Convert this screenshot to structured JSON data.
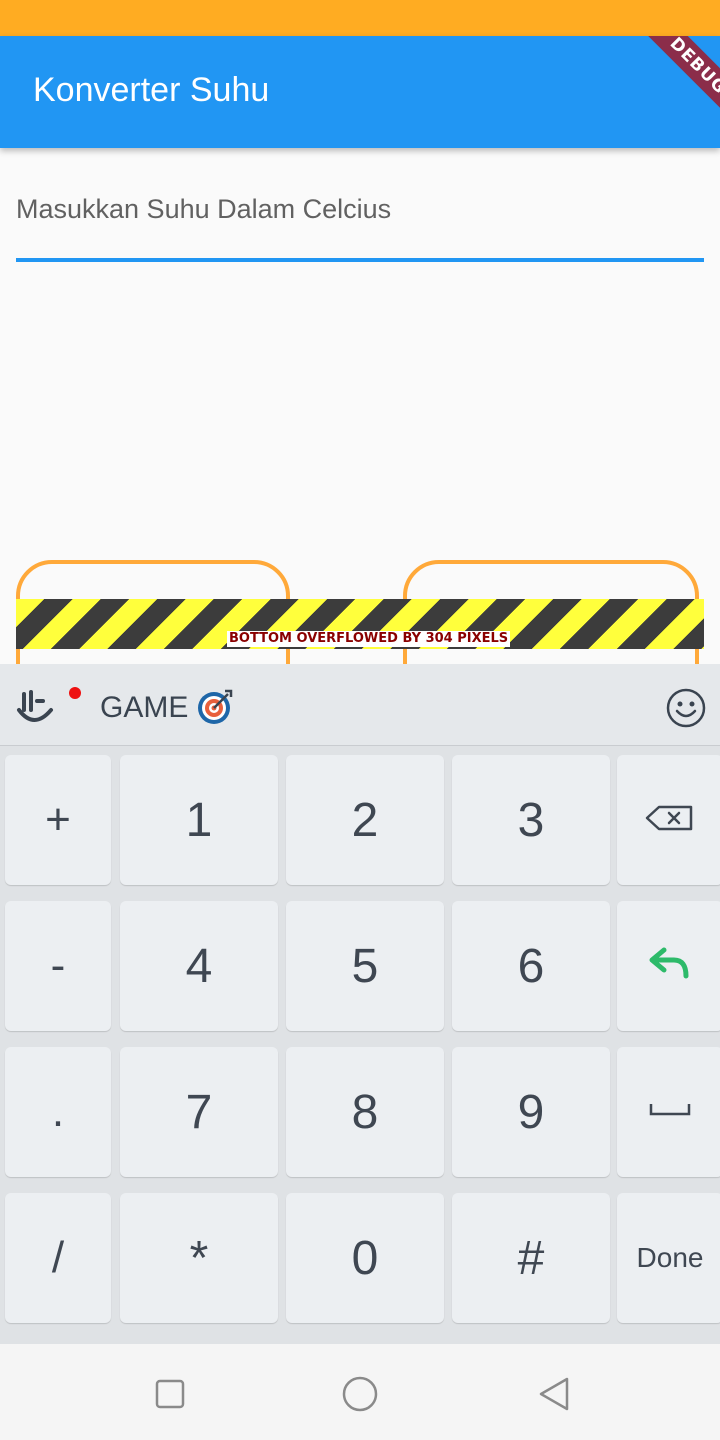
{
  "status_bar": {},
  "app_bar": {
    "title": "Konverter Suhu",
    "debug_banner": "DEBUG"
  },
  "form": {
    "input_label": "Masukkan Suhu Dalam Celcius",
    "input_value": ""
  },
  "overflow_warning": "BOTTOM OVERFLOWED BY 304 PIXELS",
  "keyboard": {
    "toolbar": {
      "game_label": "GAME",
      "icons": [
        "hand-icon",
        "notification-dot",
        "target-icon",
        "emoji-icon"
      ]
    },
    "rows": [
      [
        "+",
        "1",
        "2",
        "3",
        "backspace"
      ],
      [
        "-",
        "4",
        "5",
        "6",
        "enter"
      ],
      [
        ".",
        "7",
        "8",
        "9",
        "space"
      ],
      [
        "/",
        "*",
        "0",
        "#",
        "Done"
      ]
    ],
    "keys": {
      "plus": "+",
      "one": "1",
      "two": "2",
      "three": "3",
      "minus": "-",
      "four": "4",
      "five": "5",
      "six": "6",
      "dot": ".",
      "seven": "7",
      "eight": "8",
      "nine": "9",
      "slash": "/",
      "star": "*",
      "zero": "0",
      "hash": "#",
      "done": "Done"
    }
  },
  "nav_bar": {
    "buttons": [
      "recent-apps-icon",
      "home-icon",
      "back-icon"
    ]
  },
  "colors": {
    "status_bar": "#ffac22",
    "app_bar": "#2196f3",
    "input_underline": "#2196f3",
    "button_outline": "#ffa93a",
    "enter_key": "#2dba6a"
  }
}
